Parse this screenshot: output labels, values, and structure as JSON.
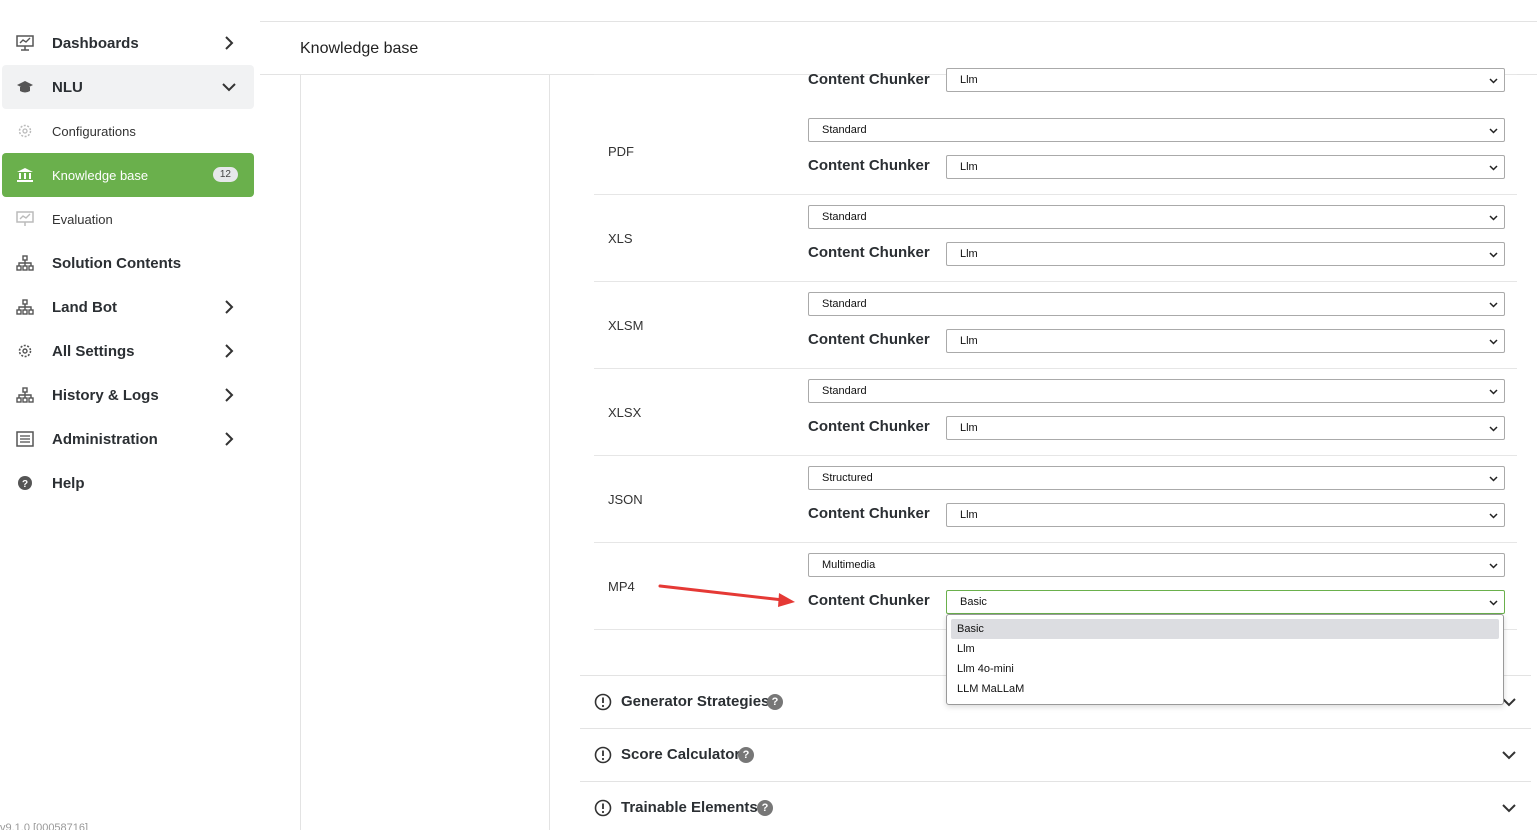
{
  "sidebar": {
    "items": [
      {
        "label": "Dashboards",
        "icon": "chart-presentation-icon"
      },
      {
        "label": "NLU",
        "icon": "graduation-cap-icon"
      },
      {
        "label": "Configurations",
        "icon": "gear-icon"
      },
      {
        "label": "Knowledge base",
        "icon": "bank-icon",
        "badge": "12"
      },
      {
        "label": "Evaluation",
        "icon": "chart-presentation-icon"
      },
      {
        "label": "Solution Contents",
        "icon": "sitemap-icon"
      },
      {
        "label": "Land Bot",
        "icon": "sitemap-icon"
      },
      {
        "label": "All Settings",
        "icon": "gear-icon"
      },
      {
        "label": "History & Logs",
        "icon": "sitemap-icon"
      },
      {
        "label": "Administration",
        "icon": "admin-panel-icon"
      },
      {
        "label": "Help",
        "icon": "question-circle-icon"
      }
    ],
    "version": "v9.1.0 [00058716]"
  },
  "header": {
    "title": "Knowledge base"
  },
  "chunker_label": "Content Chunker",
  "partial_row": {
    "chunker": "Llm"
  },
  "rows": [
    {
      "type": "PDF",
      "strategy": "Standard",
      "chunker": "Llm"
    },
    {
      "type": "XLS",
      "strategy": "Standard",
      "chunker": "Llm"
    },
    {
      "type": "XLSM",
      "strategy": "Standard",
      "chunker": "Llm"
    },
    {
      "type": "XLSX",
      "strategy": "Standard",
      "chunker": "Llm"
    },
    {
      "type": "JSON",
      "strategy": "Structured",
      "chunker": "Llm"
    },
    {
      "type": "MP4",
      "strategy": "Multimedia",
      "chunker": "Basic"
    }
  ],
  "dropdown": {
    "options": [
      "Basic",
      "Llm",
      "Llm 4o-mini",
      "LLM MaLLaM"
    ],
    "selected": "Basic"
  },
  "accordions": [
    {
      "title": "Generator Strategies"
    },
    {
      "title": "Score Calculator"
    },
    {
      "title": "Trainable Elements"
    }
  ],
  "colors": {
    "accent": "#6ab04c",
    "annotation_arrow": "#e53935"
  }
}
